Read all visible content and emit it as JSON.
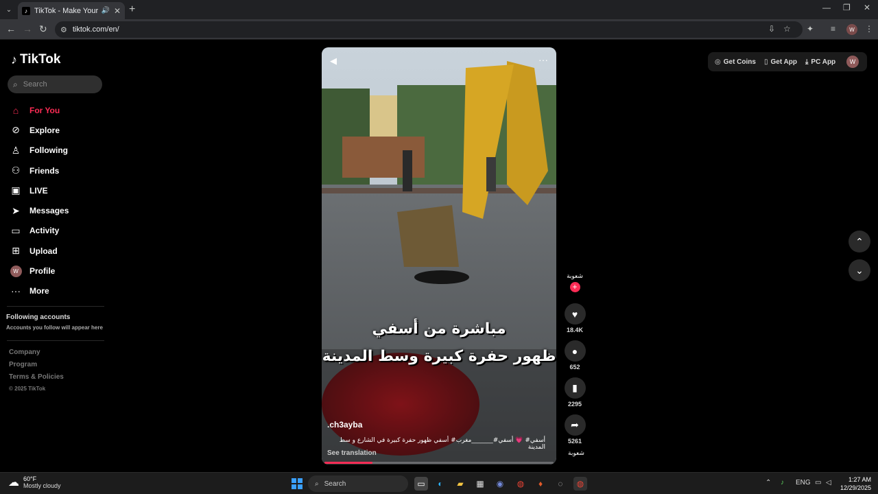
{
  "browser": {
    "tab_title": "TikTok - Make Your Day",
    "url": "tiktok.com/en/",
    "avatar_letter": "W"
  },
  "sidebar": {
    "logo": "TikTok",
    "search_placeholder": "Search",
    "nav": [
      {
        "label": "For You",
        "icon": "home-icon",
        "active": true
      },
      {
        "label": "Explore",
        "icon": "compass-icon"
      },
      {
        "label": "Following",
        "icon": "person-icon"
      },
      {
        "label": "Friends",
        "icon": "friends-icon"
      },
      {
        "label": "LIVE",
        "icon": "live-icon"
      },
      {
        "label": "Messages",
        "icon": "send-icon"
      },
      {
        "label": "Activity",
        "icon": "activity-icon"
      },
      {
        "label": "Upload",
        "icon": "upload-icon"
      },
      {
        "label": "Profile",
        "icon": "avatar",
        "avatar_letter": "W"
      },
      {
        "label": "More",
        "icon": "more-icon"
      }
    ],
    "following_title": "Following accounts",
    "following_sub": "Accounts you follow will appear here",
    "footer": [
      "Company",
      "Program",
      "Terms & Policies"
    ],
    "copyright": "© 2025 TikTok"
  },
  "video": {
    "caption_line1": "مباشرة من أسفي",
    "caption_line2": "ظهور حفرة كبيرة وسط المدينة",
    "username": ".ch3ayba",
    "description": "أسفي# 💗 أسفي#_______مغرب# أسفي ظهور حفرة كبيرة في الشارع و سط المدينة",
    "see_translation": "See translation",
    "progress": 0.21
  },
  "actions": {
    "author": "شعوبة",
    "likes": "18.4K",
    "comments": "652",
    "saves": "2295",
    "shares": "5261",
    "author_bottom": "شعوبة"
  },
  "topright": {
    "get_coins": "Get Coins",
    "get_app": "Get App",
    "pc_app": "PC App",
    "avatar_letter": "W"
  },
  "taskbar": {
    "temp": "60°F",
    "weather": "Mostly cloudy",
    "search": "Search",
    "lang": "ENG",
    "time": "1:27 AM",
    "date": "12/29/2025"
  },
  "colors": {
    "accent": "#fe2c55",
    "background": "#000000"
  }
}
